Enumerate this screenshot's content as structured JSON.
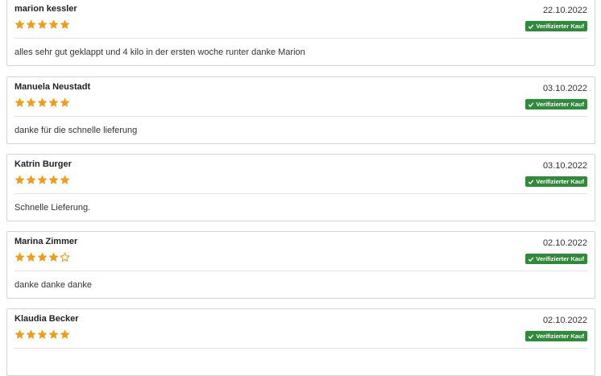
{
  "badge_label": "Verifizierter Kauf",
  "colors": {
    "star": "#f39c12",
    "badge": "#2e8b3a"
  },
  "reviews": [
    {
      "name": "marion kessler",
      "date": "22.10.2022",
      "rating": 5,
      "text": "alles sehr gut geklappt und 4 kilo in der ersten woche runter danke Marion"
    },
    {
      "name": "Manuela Neustadt",
      "date": "03.10.2022",
      "rating": 5,
      "text": "danke für die schnelle lieferung"
    },
    {
      "name": "Katrin Burger",
      "date": "03.10.2022",
      "rating": 5,
      "text": "Schnelle Lieferung."
    },
    {
      "name": "Marina Zimmer",
      "date": "02.10.2022",
      "rating": 4,
      "text": "danke danke danke"
    },
    {
      "name": "Klaudia Becker",
      "date": "02.10.2022",
      "rating": 5,
      "text": ""
    }
  ]
}
